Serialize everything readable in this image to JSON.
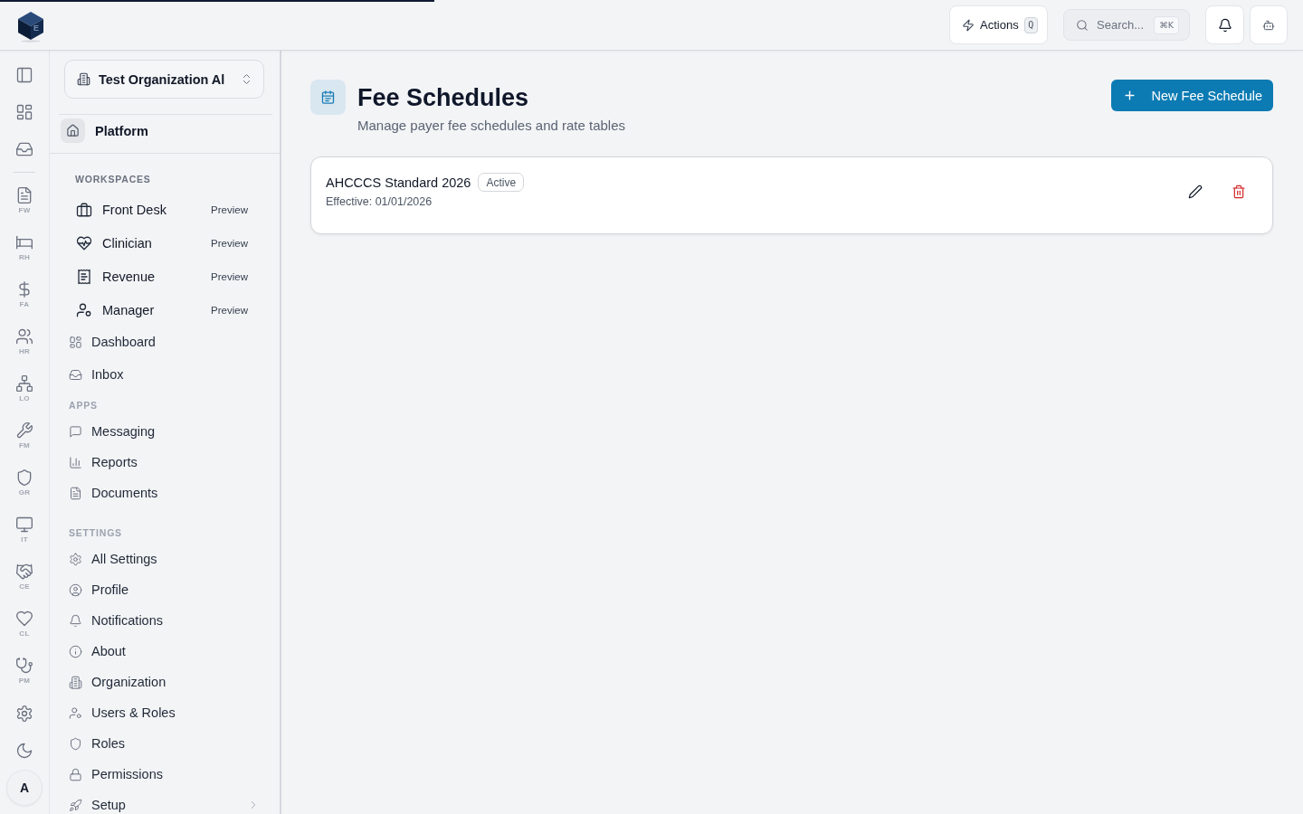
{
  "loading_bar": {
    "level": 0.333
  },
  "header": {
    "logo_letter": "E",
    "actions_button": {
      "label": "Actions",
      "shortcut": "Q"
    },
    "search": {
      "placeholder": "Search...",
      "shortcut": "⌘K"
    }
  },
  "rail": {
    "modules": [
      "FW",
      "RH",
      "FA",
      "HR",
      "LO",
      "FM",
      "GR",
      "IT",
      "CE",
      "CL",
      "PM"
    ],
    "avatar_initial": "A"
  },
  "sidebar": {
    "organization": "Test Organization Al",
    "platform": "Platform",
    "workspaces": {
      "title": "WORKSPACES",
      "items": [
        {
          "label": "Front Desk",
          "badge": "Preview"
        },
        {
          "label": "Clinician",
          "badge": "Preview"
        },
        {
          "label": "Revenue",
          "badge": "Preview"
        },
        {
          "label": "Manager",
          "badge": "Preview"
        }
      ]
    },
    "groups": [
      {
        "items": [
          {
            "label": "Dashboard",
            "kind": "link"
          },
          {
            "label": "Inbox",
            "kind": "link"
          }
        ]
      },
      {
        "title": "APPS",
        "items": [
          {
            "label": "Messaging",
            "kind": "link"
          },
          {
            "label": "Reports",
            "kind": "link"
          },
          {
            "label": "Documents",
            "kind": "link"
          }
        ]
      },
      {
        "title": "SETTINGS",
        "items": [
          {
            "label": "All Settings",
            "kind": "link"
          },
          {
            "label": "Profile",
            "kind": "link"
          },
          {
            "label": "Notifications",
            "kind": "link"
          },
          {
            "label": "About",
            "kind": "link"
          },
          {
            "label": "Organization",
            "kind": "link"
          },
          {
            "label": "Users & Roles",
            "kind": "link"
          },
          {
            "label": "Roles",
            "kind": "link"
          },
          {
            "label": "Permissions",
            "kind": "link"
          },
          {
            "label": "Setup",
            "kind": "submenu"
          }
        ]
      }
    ]
  },
  "page": {
    "title": "Fee Schedules",
    "subtitle": "Manage payer fee schedules and rate tables",
    "new_button": "New Fee Schedule"
  },
  "fee_schedules": [
    {
      "name": "AHCCCS Standard 2026",
      "status": "Active",
      "effective": "Effective: 01/01/2026"
    }
  ]
}
